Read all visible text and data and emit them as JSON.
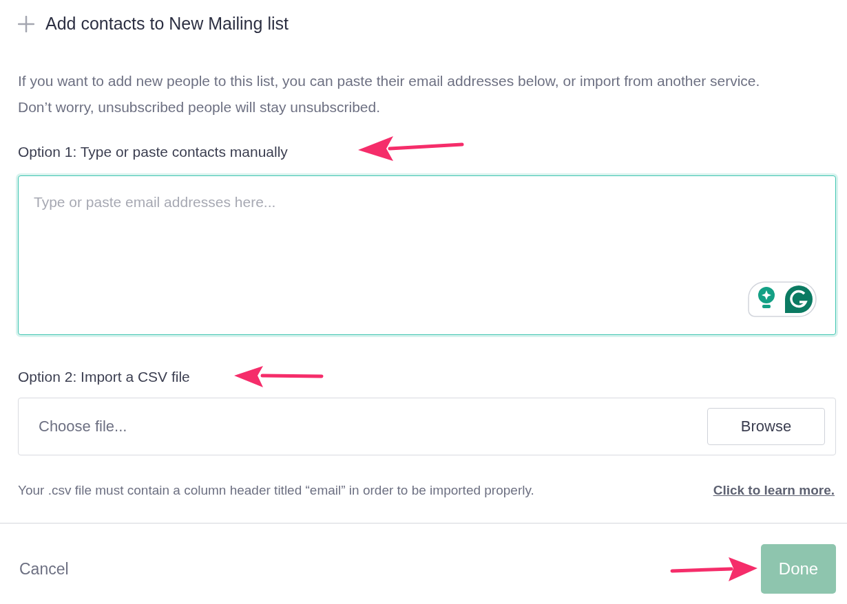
{
  "title": "Add contacts to New Mailing list",
  "description": "If you want to add new people to this list, you can paste their email addresses below, or import from another service. Don’t worry, unsubscribed people will stay unsubscribed.",
  "option_1": {
    "label": "Option 1: Type or paste contacts manually",
    "placeholder": "Type or paste email addresses here..."
  },
  "option_2": {
    "label": "Option 2: Import a CSV file",
    "placeholder": "Choose file...",
    "button": "Browse"
  },
  "note": {
    "text": "Your .csv file must contain a column header titled “email” in order to be imported properly.",
    "link": "Click to learn more."
  },
  "footer": {
    "cancel": "Cancel",
    "done": {
      "label": "Done",
      "disabled": true
    }
  }
}
